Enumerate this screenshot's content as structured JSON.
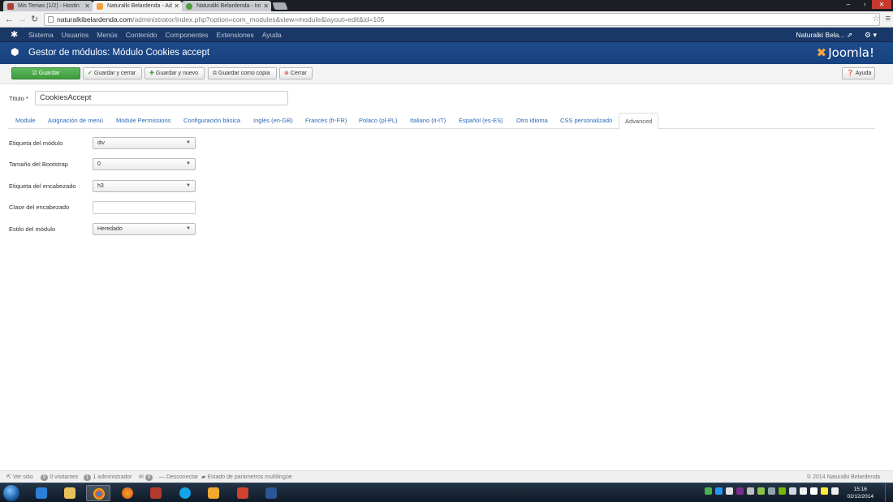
{
  "browser": {
    "tabs": [
      {
        "label": "Mis Temas (1/2) - Hostin",
        "favicon_color": "#b53a2f"
      },
      {
        "label": "Naturalki Belardenda - Ad",
        "favicon_color": "#f4a13c"
      },
      {
        "label": "Naturalki Belardenda - Ini",
        "favicon_color": "#4a9e3f"
      }
    ],
    "url_domain": "naturalkibelardenda.com",
    "url_path": "/administrator/index.php?option=com_modules&view=module&layout=edit&id=105"
  },
  "joomla_nav": {
    "items": [
      "Sistema",
      "Usuarios",
      "Menús",
      "Contenido",
      "Componentes",
      "Extensiones",
      "Ayuda"
    ],
    "user": "Naturalki Bela..."
  },
  "header": {
    "title": "Gestor de módulos: Módulo Cookies accept",
    "brand": "Joomla!"
  },
  "toolbar": {
    "save": "Guardar",
    "save_close": "Guardar y cerrar",
    "save_new": "Guardar y nuevo",
    "save_copy": "Guardar como copia",
    "close": "Cerrar",
    "help": "Ayuda"
  },
  "form": {
    "title_label": "Título *",
    "title_value": "CookiesAccept",
    "tabs": [
      "Module",
      "Asignación de menú",
      "Module Permissions",
      "Configuración básica",
      "Inglés (en-GB)",
      "Francés (fr-FR)",
      "Polaco (pl-PL)",
      "Italiano (it-IT)",
      "Español (es-ES)",
      "Otro idioma",
      "CSS personalizado",
      "Advanced"
    ],
    "active_tab": "Advanced",
    "fields": [
      {
        "label": "Etiqueta del módulo",
        "value": "div"
      },
      {
        "label": "Tamaño del Bootstrap",
        "value": "0"
      },
      {
        "label": "Etiqueta del encabezado",
        "value": "h3"
      },
      {
        "label": "Clase del encabezado",
        "value": ""
      },
      {
        "label": "Estilo del módulo",
        "value": "Heredado"
      }
    ]
  },
  "status": {
    "view_site": "Ver sitio",
    "visitors_count": "0",
    "visitors_label": "0 visitantes",
    "admin_count": "1",
    "admin_label": "1 administrador",
    "messages_count": "0",
    "logout": "Desconectar",
    "multilang": "Estado de parámetros multilingüe",
    "copyright": "© 2014 Naturalki Belardenda"
  },
  "taskbar": {
    "time": "15:16",
    "date": "02/12/2014"
  }
}
